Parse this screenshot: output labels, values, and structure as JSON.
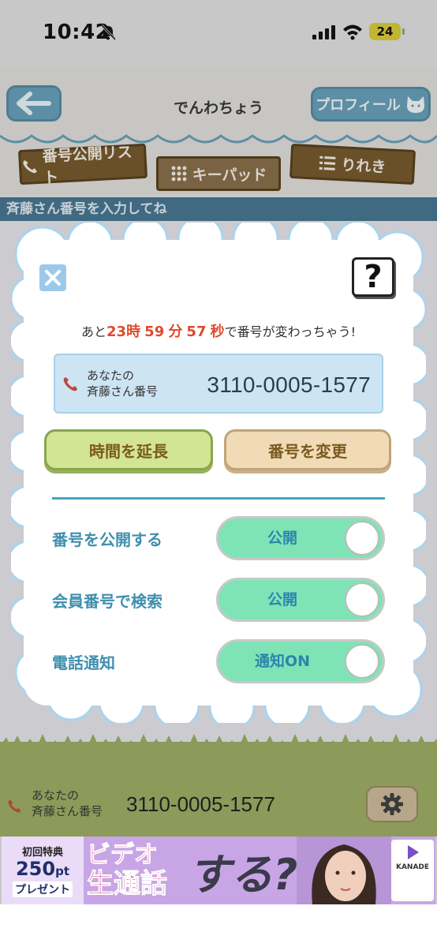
{
  "status_bar": {
    "time": "10:42",
    "battery": "24"
  },
  "header": {
    "title": "でんわちょう",
    "profile_label": "プロフィール",
    "tabs": [
      {
        "label": "番号公開リスト"
      },
      {
        "label": "キーパッド"
      },
      {
        "label": "りれき"
      }
    ],
    "subbar_text": "斉藤さん番号を入力してね"
  },
  "modal": {
    "help_label": "?",
    "countdown": {
      "prefix": "あと",
      "hours": "23",
      "h_unit": "時",
      "minutes": "59",
      "m_unit": "分",
      "seconds": "57",
      "s_unit": "秒",
      "suffix": "で番号が変わっちゃう!"
    },
    "number_label_line1": "あなたの",
    "number_label_line2": "斉藤さん番号",
    "number": "3110-0005-1577",
    "extend_button": "時間を延長",
    "change_button": "番号を変更",
    "settings": [
      {
        "label": "番号を公開する",
        "toggle_text": "公開"
      },
      {
        "label": "会員番号で検索",
        "toggle_text": "公開"
      },
      {
        "label": "電話通知",
        "toggle_text": "通知ON"
      }
    ]
  },
  "bottom_bar": {
    "label_line1": "あなたの",
    "label_line2": "斉藤さん番号",
    "number": "3110-0005-1577"
  },
  "ad": {
    "line1": "初回特典",
    "points": "250",
    "points_unit": "pt",
    "present": "プレゼント",
    "video1": "ビデオ",
    "video2": "生通話",
    "suru": "する?",
    "brand": "KANADE"
  },
  "colors": {
    "accent_teal": "#3fa6bd",
    "countdown_red": "#e04a2d",
    "toggle_green": "#7ee4b6",
    "header_button": "#5c8fa6"
  }
}
